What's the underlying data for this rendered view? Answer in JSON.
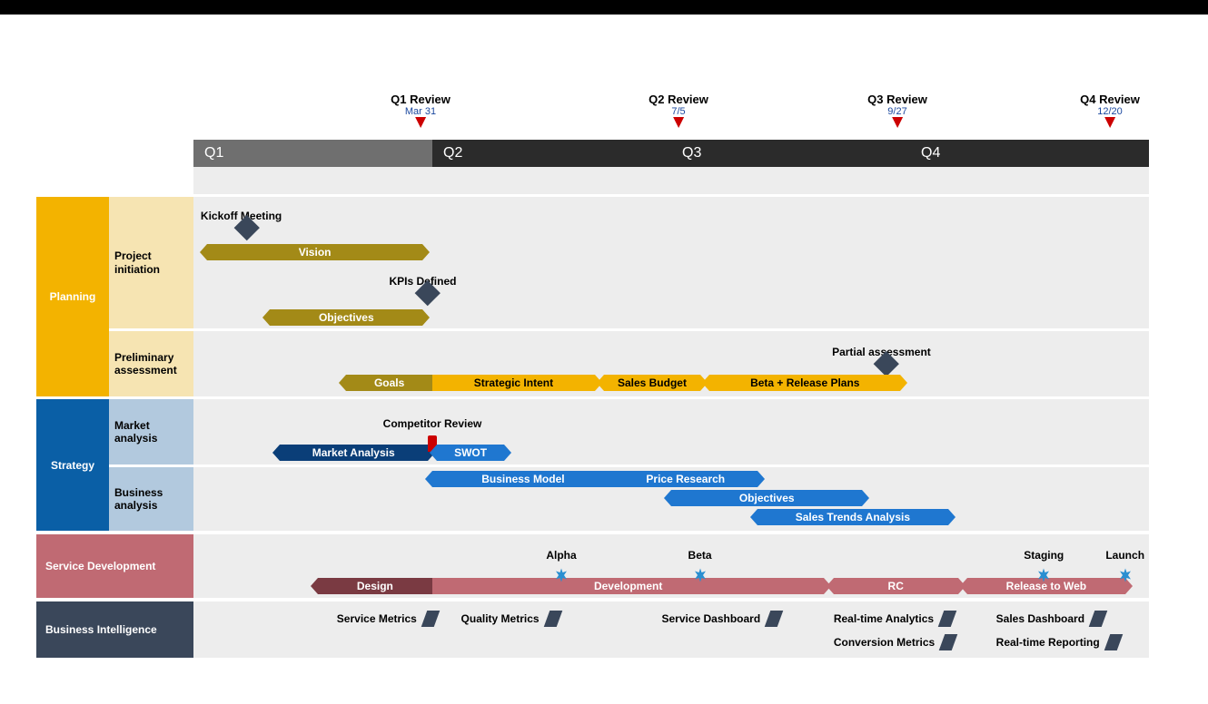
{
  "reviews": [
    {
      "label": "Q1 Review",
      "date": "Mar 31",
      "x_pct": 24
    },
    {
      "label": "Q2 Review",
      "date": "7/5",
      "x_pct": 51
    },
    {
      "label": "Q3 Review",
      "date": "9/27",
      "x_pct": 74
    },
    {
      "label": "Q4 Review",
      "date": "12/20",
      "x_pct": 96
    }
  ],
  "quarters": [
    "Q1",
    "Q2",
    "Q3",
    "Q4"
  ],
  "sections": {
    "planning": {
      "label": "Planning",
      "sub1": "Project initiation",
      "sub2": "Preliminary assessment"
    },
    "strategy": {
      "label": "Strategy",
      "sub1": "Market analysis",
      "sub2": "Business analysis"
    },
    "service": {
      "label": "Service Development"
    },
    "bi": {
      "label": "Business Intelligence"
    }
  },
  "milestones": {
    "kickoff": "Kickoff Meeting",
    "kpis": "KPIs Defined",
    "partial": "Partial assessment",
    "comp": "Competitor Review"
  },
  "bars": {
    "vision": "Vision",
    "objectives": "Objectives",
    "goals": "Goals",
    "intent": "Strategic Intent",
    "budget": "Sales Budget",
    "beta_rel": "Beta + Release Plans",
    "market": "Market Analysis",
    "swot": "SWOT",
    "bizmodel": "Business Model",
    "price": "Price Research",
    "obj2": "Objectives",
    "trends": "Sales Trends Analysis",
    "design": "Design",
    "dev": "Development",
    "rc": "RC",
    "rtw": "Release to Web"
  },
  "svc_ms": {
    "alpha": "Alpha",
    "beta": "Beta",
    "staging": "Staging",
    "launch": "Launch"
  },
  "bi_items": {
    "sm": "Service Metrics",
    "qm": "Quality Metrics",
    "sd": "Service Dashboard",
    "rta": "Real-time Analytics",
    "sdb": "Sales Dashboard",
    "cm": "Conversion Metrics",
    "rtr": "Real-time Reporting"
  },
  "chart_data": {
    "type": "gantt-timeline",
    "x_axis": {
      "categories": [
        "Q1",
        "Q2",
        "Q3",
        "Q4"
      ],
      "range_pct": [
        0,
        100
      ]
    },
    "reviews": [
      {
        "name": "Q1 Review",
        "date": "Mar 31",
        "x_pct": 24
      },
      {
        "name": "Q2 Review",
        "date": "7/5",
        "x_pct": 51
      },
      {
        "name": "Q3 Review",
        "date": "9/27",
        "x_pct": 74
      },
      {
        "name": "Q4 Review",
        "date": "12/20",
        "x_pct": 96
      }
    ],
    "lanes": [
      {
        "section": "Planning",
        "sublane": "Project initiation",
        "bars": [
          {
            "label": "Vision",
            "start_pct": 1.4,
            "end_pct": 24,
            "color": "olive"
          },
          {
            "label": "Objectives",
            "start_pct": 8,
            "end_pct": 24,
            "color": "olive"
          }
        ],
        "milestones": [
          {
            "label": "Kickoff Meeting",
            "x_pct": 5,
            "shape": "diamond"
          },
          {
            "label": "KPIs Defined",
            "x_pct": 24,
            "shape": "diamond"
          }
        ]
      },
      {
        "section": "Planning",
        "sublane": "Preliminary assessment",
        "bars": [
          {
            "label": "Goals",
            "start_pct": 16,
            "end_pct": 25,
            "color": "olive"
          },
          {
            "label": "Strategic Intent",
            "start_pct": 25,
            "end_pct": 42,
            "color": "amber"
          },
          {
            "label": "Sales Budget",
            "start_pct": 43,
            "end_pct": 53,
            "color": "amber"
          },
          {
            "label": "Beta + Release Plans",
            "start_pct": 54,
            "end_pct": 74,
            "color": "amber"
          }
        ],
        "milestones": [
          {
            "label": "Partial assessment",
            "x_pct": 72,
            "shape": "diamond"
          }
        ]
      },
      {
        "section": "Strategy",
        "sublane": "Market analysis",
        "bars": [
          {
            "label": "Market Analysis",
            "start_pct": 9,
            "end_pct": 24.5,
            "color": "navy"
          },
          {
            "label": "SWOT",
            "start_pct": 25.5,
            "end_pct": 32.5,
            "color": "blue"
          }
        ],
        "milestones": [
          {
            "label": "Competitor Review",
            "x_pct": 25,
            "shape": "flag-red"
          }
        ]
      },
      {
        "section": "Strategy",
        "sublane": "Business analysis",
        "bars": [
          {
            "label": "Business Model",
            "start_pct": 25,
            "end_pct": 44,
            "color": "blue"
          },
          {
            "label": "Price Research",
            "start_pct": 44,
            "end_pct": 59,
            "color": "blue"
          },
          {
            "label": "Objectives",
            "start_pct": 50,
            "end_pct": 70,
            "color": "blue"
          },
          {
            "label": "Sales Trends Analysis",
            "start_pct": 59,
            "end_pct": 79,
            "color": "blue"
          }
        ]
      },
      {
        "section": "Service Development",
        "bars": [
          {
            "label": "Design",
            "start_pct": 13,
            "end_pct": 25,
            "color": "maroon"
          },
          {
            "label": "Development",
            "start_pct": 25,
            "end_pct": 66,
            "color": "rose"
          },
          {
            "label": "RC",
            "start_pct": 67,
            "end_pct": 80,
            "color": "rose"
          },
          {
            "label": "Release to Web",
            "start_pct": 81,
            "end_pct": 97.5,
            "color": "rose"
          }
        ],
        "milestones": [
          {
            "label": "Alpha",
            "x_pct": 38.5,
            "shape": "star"
          },
          {
            "label": "Beta",
            "x_pct": 53,
            "shape": "star"
          },
          {
            "label": "Staging",
            "x_pct": 89,
            "shape": "star"
          },
          {
            "label": "Launch",
            "x_pct": 97.5,
            "shape": "star"
          }
        ]
      },
      {
        "section": "Business Intelligence",
        "points": [
          {
            "label": "Service Metrics",
            "x_pct": 15,
            "row": 1
          },
          {
            "label": "Quality Metrics",
            "x_pct": 28,
            "row": 1
          },
          {
            "label": "Service Dashboard",
            "x_pct": 49,
            "row": 1
          },
          {
            "label": "Real-time Analytics",
            "x_pct": 67,
            "row": 1
          },
          {
            "label": "Sales Dashboard",
            "x_pct": 84,
            "row": 1
          },
          {
            "label": "Conversion Metrics",
            "x_pct": 67,
            "row": 2
          },
          {
            "label": "Real-time Reporting",
            "x_pct": 84,
            "row": 2
          }
        ]
      }
    ]
  }
}
